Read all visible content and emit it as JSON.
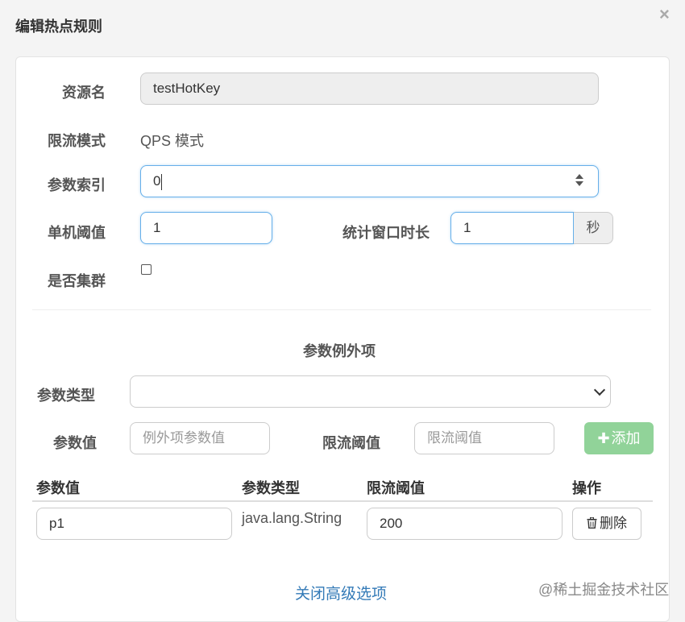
{
  "dialog": {
    "title": "编辑热点规则",
    "close_label": "×"
  },
  "form": {
    "resource_label": "资源名",
    "resource_value": "testHotKey",
    "mode_label": "限流模式",
    "mode_value": "QPS 模式",
    "param_index_label": "参数索引",
    "param_index_value": "0",
    "threshold_label": "单机阈值",
    "threshold_value": "1",
    "window_label": "统计窗口时长",
    "window_value": "1",
    "window_unit": "秒",
    "cluster_label": "是否集群",
    "cluster_checked": false
  },
  "exceptions": {
    "section_title": "参数例外项",
    "param_type_label": "参数类型",
    "param_type_selected": "",
    "param_value_label": "参数值",
    "param_value_placeholder": "例外项参数值",
    "limit_label": "限流阈值",
    "limit_placeholder": "限流阈值",
    "add_button": "添加",
    "table": {
      "headers": [
        "参数值",
        "参数类型",
        "限流阈值",
        "操作"
      ],
      "rows": [
        {
          "param_value": "p1",
          "param_type": "java.lang.String",
          "limit": "200",
          "action": "删除"
        }
      ]
    }
  },
  "footer": {
    "toggle_advanced": "关闭高级选项",
    "watermark": "@稀土掘金技术社区"
  },
  "colors": {
    "link": "#337ab7",
    "add_button": "#91d399",
    "focus_border": "#66afe9"
  }
}
